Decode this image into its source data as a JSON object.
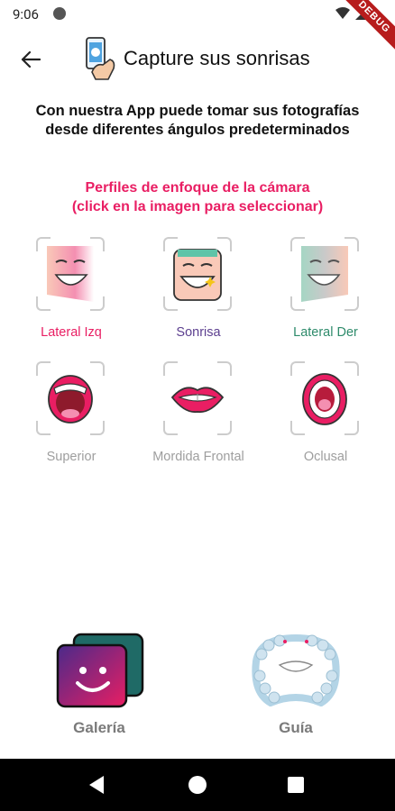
{
  "status": {
    "time": "9:06",
    "debug": "DEBUG"
  },
  "header": {
    "title": "Capture sus sonrisas"
  },
  "intro": {
    "line1": "Con nuestra App puede tomar sus fotografías",
    "line2": "desde diferentes ángulos predeterminados"
  },
  "section": {
    "line1": "Perfiles de enfoque de la cámara",
    "line2": "(click en la imagen para seleccionar)"
  },
  "profiles": [
    {
      "label": "Lateral Izq",
      "color": "#e91e63"
    },
    {
      "label": "Sonrisa",
      "color": "#5c3f8f"
    },
    {
      "label": "Lateral Der",
      "color": "#2e8b6b"
    },
    {
      "label": "Superior",
      "color": "#9e9e9e"
    },
    {
      "label": "Mordida Frontal",
      "color": "#9e9e9e"
    },
    {
      "label": "Oclusal",
      "color": "#9e9e9e"
    }
  ],
  "bottom": {
    "gallery": "Galería",
    "guide": "Guía"
  },
  "colors": {
    "accent": "#e91e63",
    "purple": "#6a1b9a",
    "muted": "#9e9e9e"
  }
}
